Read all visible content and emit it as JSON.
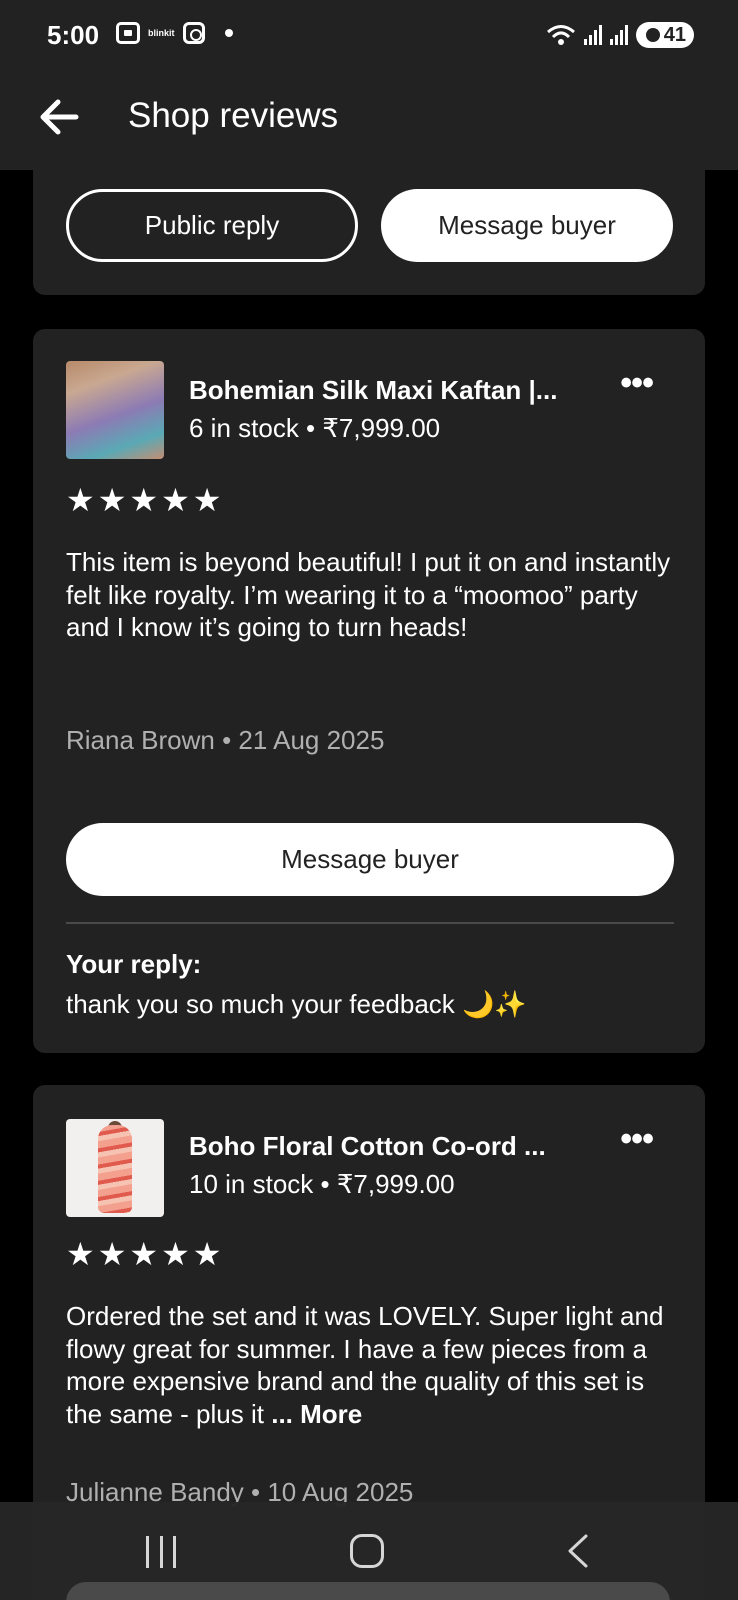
{
  "status_bar": {
    "time": "5:00",
    "app_label": "blinkit",
    "battery": "41",
    "icons": [
      "screen-record-icon",
      "blinkit-icon",
      "instagram-icon",
      "notification-dot-icon",
      "wifi-icon",
      "signal-icon",
      "signal-icon",
      "battery-icon"
    ]
  },
  "app_bar": {
    "title": "Shop reviews",
    "back_icon": "back-arrow-icon"
  },
  "partial_card": {
    "public_reply_label": "Public reply",
    "message_buyer_label": "Message buyer"
  },
  "reviews": [
    {
      "item_title": "Bohemian Silk Maxi Kaftan |...",
      "item_meta": "6 in stock • ₹7,999.00",
      "stars": "★★★★★",
      "rating": 5,
      "text": "This item is beyond beautiful! I put it on and instantly felt like royalty. I’m wearing it to a “moomoo” party and I know it’s going to turn heads!",
      "author_date": "Riana Brown • 21 Aug 2025",
      "message_buyer_label": "Message buyer",
      "reply_label": "Your reply:",
      "reply_text": "thank you so much your feedback 🌙✨"
    },
    {
      "item_title": "Boho Floral Cotton Co-ord ...",
      "item_meta": "10 in stock • ₹7,999.00",
      "stars": "★★★★★",
      "rating": 5,
      "text": "Ordered the set and it was LOVELY. Super light and flowy great for summer. I have a few pieces from a more expensive brand and the quality of this set is the same - plus it",
      "more_label": "... More",
      "author_date": "Julianne Bandy • 10 Aug 2025"
    }
  ],
  "nav_bar": {
    "icons": [
      "recent-apps-icon",
      "home-icon",
      "back-icon"
    ]
  }
}
